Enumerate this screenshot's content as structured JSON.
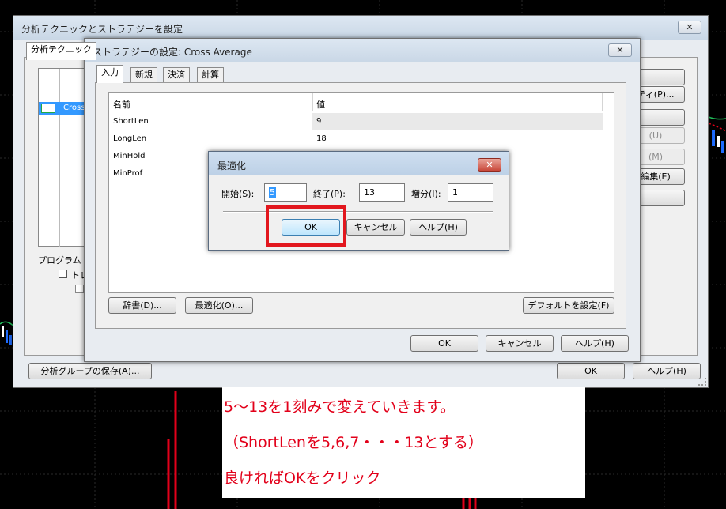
{
  "main_window": {
    "title": "分析テクニックとストラテジーを設定",
    "close_glyph": "✕",
    "tab_partial": "分析テクニック",
    "list_item_partial": "Cross",
    "section_label_partial": "プログラムトレ",
    "checkbox_label_partial": "トレ",
    "right_buttons": [
      "",
      "ティ(P)...",
      "",
      "(U)",
      "(M)",
      "編集(E)",
      ""
    ],
    "save_group_button": "分析グループの保存(A)...",
    "ok_button": "OK",
    "help_button": "ヘルプ(H)"
  },
  "strategy_dialog": {
    "title": "ストラテジーの設定: Cross Average",
    "close_glyph": "✕",
    "tabs": [
      "入力",
      "新規",
      "決済",
      "計算"
    ],
    "columns": {
      "name": "名前",
      "value": "値"
    },
    "rows": [
      {
        "name": "ShortLen",
        "value": "9"
      },
      {
        "name": "LongLen",
        "value": "18"
      },
      {
        "name": "MinHold",
        "value": ""
      },
      {
        "name": "MinProf",
        "value": ""
      }
    ],
    "dictionary_button": "辞書(D)...",
    "optimize_button": "最適化(O)...",
    "default_button": "デフォルトを設定(F)",
    "ok_button": "OK",
    "cancel_button": "キャンセル",
    "help_button": "ヘルプ(H)"
  },
  "optimize_dialog": {
    "title": "最適化",
    "close_glyph": "✕",
    "start_label": "開始(S):",
    "start_value": "5",
    "end_label": "終了(P):",
    "end_value": "13",
    "step_label": "増分(I):",
    "step_value": "1",
    "ok_button": "OK",
    "cancel_button": "キャンセル",
    "help_button": "ヘルプ(H)"
  },
  "annotation": {
    "line1": "5～13を1刻みで変えていきます。",
    "line2": "（ShortLenを5,6,7・・・13とする）",
    "line3": "良ければOKをクリック",
    "color": "#e2001a"
  }
}
